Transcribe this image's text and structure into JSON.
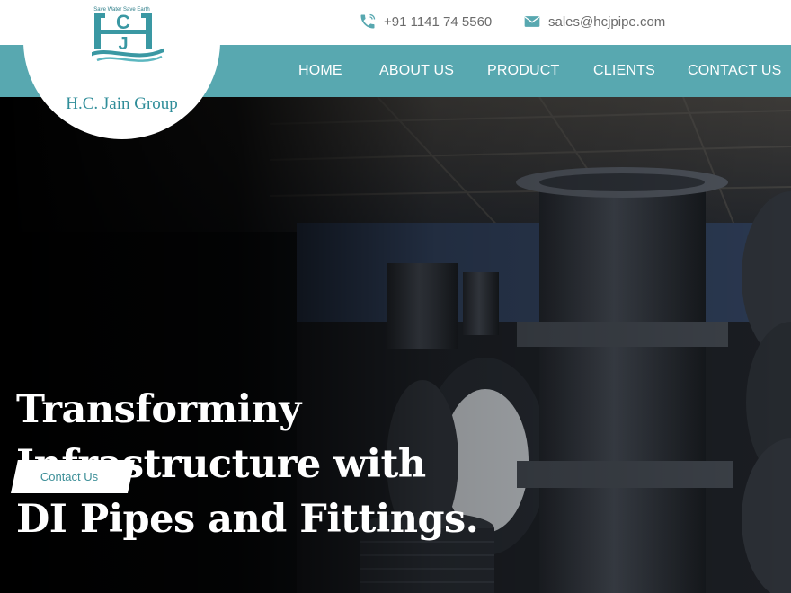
{
  "logo": {
    "tagline": "Save Water Save Earth",
    "name": "H.C. Jain Group",
    "mark_letters": "HCJ"
  },
  "contact": {
    "phone": "+91 1141 74 5560",
    "email": "sales@hcjpipe.com"
  },
  "nav": {
    "items": [
      "HOME",
      "ABOUT US",
      "PRODUCT",
      "CLIENTS",
      "CONTACT US"
    ]
  },
  "hero": {
    "title_lines": [
      "Transforminy",
      "Infrastructure with",
      "DI Pipes and Fittings."
    ],
    "cta_label": "Contact Us"
  },
  "colors": {
    "accent": "#58a8b0",
    "logo_teal": "#2f8d99",
    "text_gray": "#6b6b6b"
  },
  "icons": {
    "phone": "phone-icon",
    "email": "envelope-icon"
  }
}
